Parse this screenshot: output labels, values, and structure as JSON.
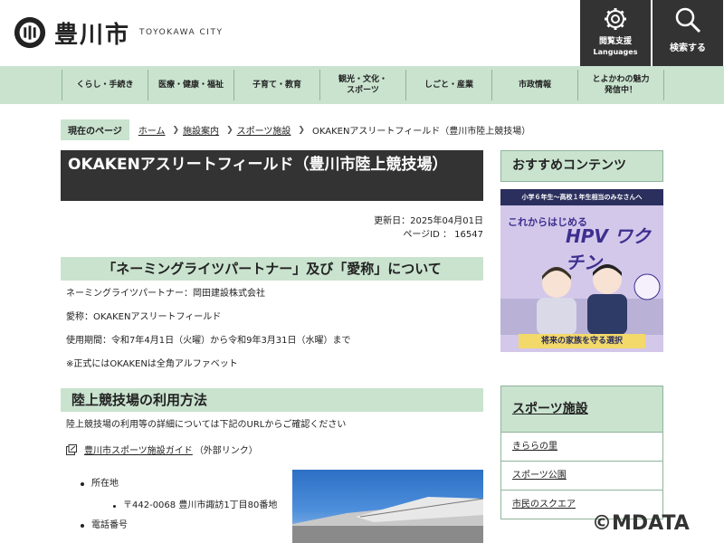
{
  "header": {
    "logo_name": "豊川市",
    "logo_en": "TOYOKAWA CITY",
    "lang_button": {
      "line1": "閲覧支援",
      "line2": "Languages"
    },
    "search_button": {
      "label": "検索する"
    }
  },
  "nav": {
    "items": [
      {
        "label": "くらし・手続き"
      },
      {
        "label": "医療・健康・福祉"
      },
      {
        "label": "子育て・教育"
      },
      {
        "label": "観光・文化・\nスポーツ"
      },
      {
        "label": "しごと・産業"
      },
      {
        "label": "市政情報"
      },
      {
        "label": "とよかわの魅力\n発信中！"
      }
    ]
  },
  "breadcrumb": {
    "current_label": "現在のページ",
    "links": [
      "ホーム",
      "施設案内",
      "スポーツ施設"
    ],
    "last": "OKAKENアスリートフィールド（豊川市陸上競技場）"
  },
  "main": {
    "title": "OKAKENアスリートフィールド（豊川市陸上競技場）",
    "updated": "更新日：2025年04月01日",
    "page_id": "ページID ： 16547",
    "section1": {
      "heading": "「ネーミングライツパートナー」及び「愛称」について",
      "lines": [
        "ネーミングライツパートナー：岡田建設株式会社",
        "愛称：OKAKENアスリートフィールド",
        "使用期間：令和7年4月1日（火曜）から令和9年3月31日（水曜）まで",
        "※正式にはOKAKENは全角アルファベット"
      ]
    },
    "section2": {
      "heading": "陸上競技場の利用方法",
      "intro": "陸上競技場の利用等の詳細については下記のURLからご確認ください",
      "link_text": "豊川市スポーツ施設ガイド",
      "link_suffix": "（外部リンク）",
      "address_label": "所在地",
      "address_value": "〒442-0068 豊川市諏訪1丁目80番地",
      "phone_label": "電話番号"
    }
  },
  "sidebar": {
    "recommend_heading": "おすすめコンテンツ",
    "banner": {
      "top": "小学６年生～高校１年生相当のみなさんへ",
      "line1": "これからはじめる",
      "line2": "HPV ワクチン",
      "bottom": "将来の家族を守る選択"
    },
    "sports_heading": "スポーツ施設",
    "sports_items": [
      "きららの里",
      "スポーツ公園",
      "市民のスクエア"
    ]
  },
  "watermark": "©MDATA",
  "colors": {
    "accent_green": "#c9e3cf",
    "dark": "#333333",
    "border_green": "#8fb49a"
  }
}
